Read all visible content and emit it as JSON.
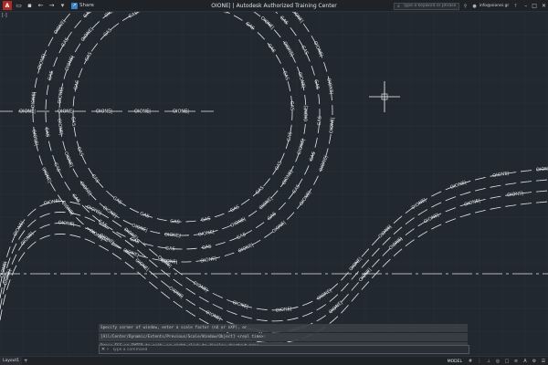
{
  "titlebar": {
    "title": "OIONE| | Autodesk Authorized Training Center",
    "share_label": "Share",
    "search_placeholder": "Type a keyword or phrase",
    "user_label": "info@oionei.gr"
  },
  "drawing": {
    "viewport_label": "[-]",
    "linetype_label_gas": "GAS",
    "linetype_label_oione": "OIONE|"
  },
  "command": {
    "history": [
      "Specify corner of window, enter a scale factor (nX or nXP), or",
      "[All/Center/Dynamic/Extents/Previous/Scale/Window/Object] <real time>:",
      "Press ESC or ENTER to exit, or right-click to display shortcut menu."
    ],
    "placeholder": "Type a command"
  },
  "statusbar": {
    "layout_tab": "Layout1",
    "model_label": "MODEL"
  },
  "colors": {
    "background": "#212830",
    "linework": "#e6e8ea",
    "grid": "#2b323b"
  }
}
